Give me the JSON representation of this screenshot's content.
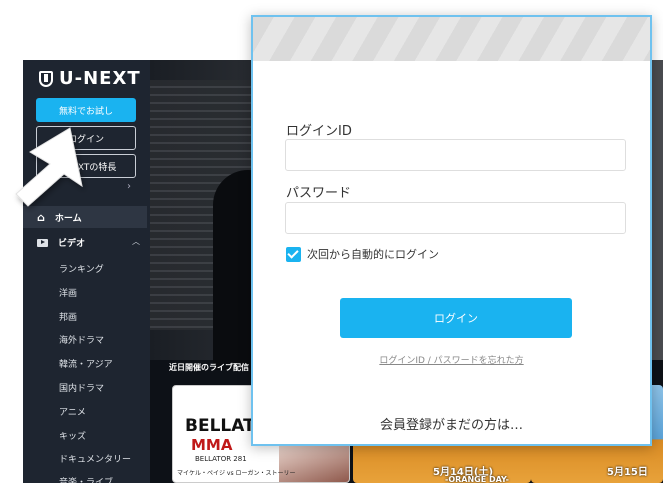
{
  "brand": {
    "name": "U-NEXT"
  },
  "sidebar": {
    "trial_label": "無料でお試し",
    "login_label": "ログイン",
    "features_label": "U-NEXTの特長",
    "home_label": "ホーム",
    "video_label": "ビデオ",
    "sub_items": [
      "ランキング",
      "洋画",
      "邦画",
      "海外ドラマ",
      "韓流・アジア",
      "国内ドラマ",
      "アニメ",
      "キッズ",
      "ドキュメンタリー",
      "音楽・ライブ"
    ]
  },
  "main": {
    "section_title": "近日開催のライブ配信",
    "cards": {
      "bellator_title": "BELLATO",
      "bellator_sub": "MMA",
      "bellator_event": "BELLATOR 281",
      "bellator_fight": "マイケル・ペイジ vs ローガン・ストーリー",
      "orange_1_date": "5月14日(土)",
      "orange_1_tag": "-ORANGE DAY-",
      "orange_2_date": "5月15日"
    }
  },
  "modal": {
    "id_label": "ログインID",
    "id_value": "",
    "password_label": "パスワード",
    "password_value": "",
    "auto_login_label": "次回から自動的にログイン",
    "auto_login_checked": true,
    "submit_label": "ログイン",
    "forgot_link": "ログインID / パスワードを忘れた方",
    "register_prompt": "会員登録がまだの方は…"
  },
  "colors": {
    "accent": "#1ab3f0",
    "sidebar_bg": "#1e2530",
    "modal_border": "#6fc2ef"
  }
}
